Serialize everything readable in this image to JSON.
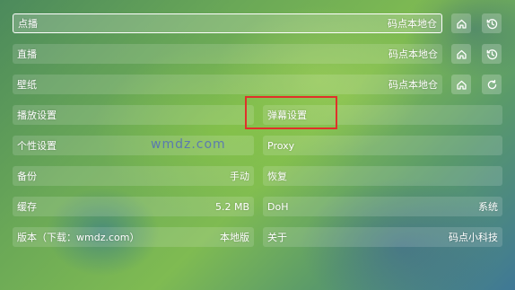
{
  "watermark": "wmdz.com",
  "rows": {
    "vod": {
      "label": "点播",
      "value": "码点本地仓"
    },
    "live": {
      "label": "直播",
      "value": "码点本地仓"
    },
    "wallpaper": {
      "label": "壁纸",
      "value": "码点本地仓"
    },
    "playback_settings": {
      "label": "播放设置"
    },
    "danmaku_settings": {
      "label": "弹幕设置"
    },
    "personal_settings": {
      "label": "个性设置"
    },
    "proxy": {
      "label": "Proxy"
    },
    "backup": {
      "label": "备份",
      "value": "手动"
    },
    "restore": {
      "label": "恢复"
    },
    "cache": {
      "label": "缓存",
      "value": "5.2 MB"
    },
    "doh": {
      "label": "DoH",
      "value": "系统"
    },
    "version": {
      "label": "版本（下载：wmdz.com）",
      "value": "本地版"
    },
    "about": {
      "label": "关于",
      "value": "码点小科技"
    }
  },
  "icons": {
    "vod_home": "home-icon",
    "vod_history": "history-icon",
    "live_home": "home-icon",
    "live_history": "history-icon",
    "wallpaper_home": "home-icon",
    "wallpaper_refresh": "refresh-icon"
  },
  "colors": {
    "highlight": "#e0312a",
    "watermark": "#4a62c8"
  }
}
